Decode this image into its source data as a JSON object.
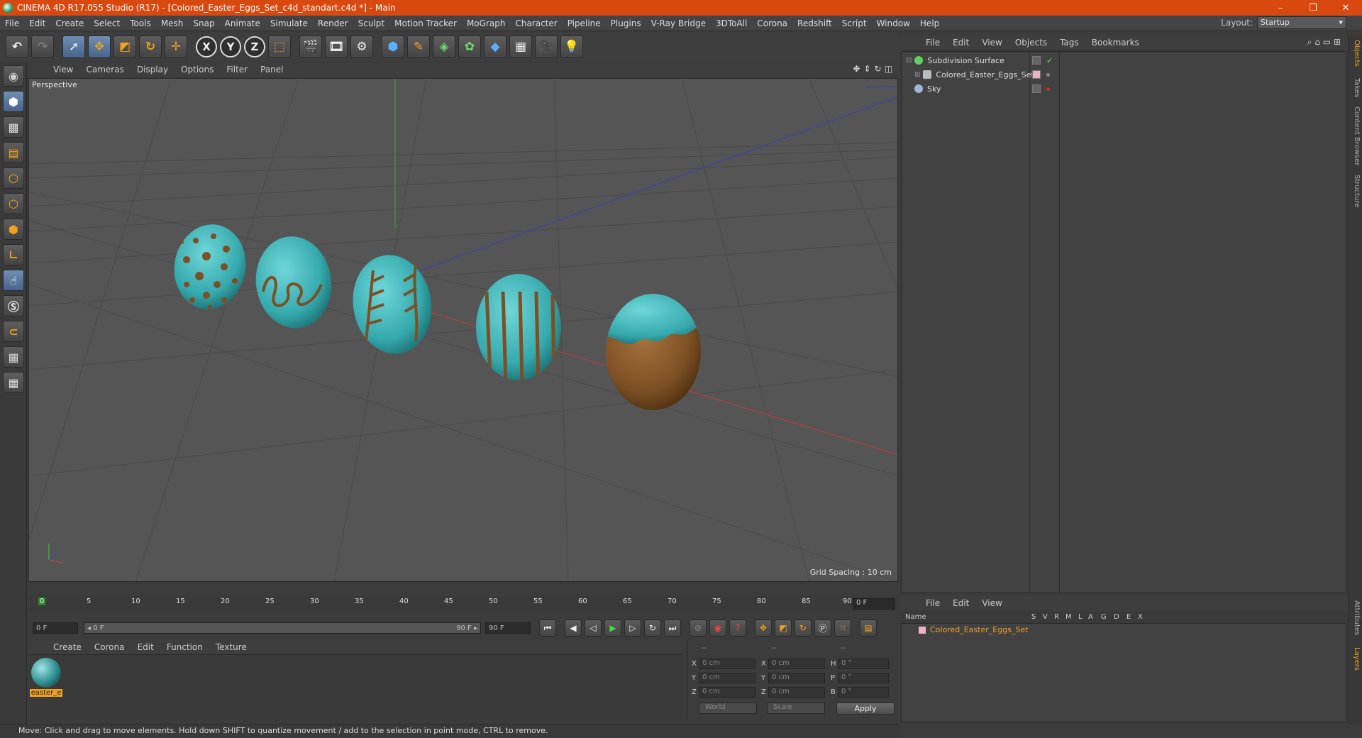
{
  "window": {
    "title": "CINEMA 4D R17.055 Studio (R17) - [Colored_Easter_Eggs_Set_c4d_standart.c4d *] - Main",
    "controls": [
      "–",
      "❐",
      "✕"
    ]
  },
  "menubar": {
    "items": [
      "File",
      "Edit",
      "Create",
      "Select",
      "Tools",
      "Mesh",
      "Snap",
      "Animate",
      "Simulate",
      "Render",
      "Sculpt",
      "Motion Tracker",
      "MoGraph",
      "Character",
      "Pipeline",
      "Plugins",
      "V-Ray Bridge",
      "3DToAll",
      "Corona",
      "Redshift",
      "Script",
      "Window",
      "Help"
    ],
    "layout_label": "Layout:",
    "layout_value": "Startup"
  },
  "viewport": {
    "menu": [
      "View",
      "Cameras",
      "Display",
      "Options",
      "Filter",
      "Panel"
    ],
    "label": "Perspective",
    "grid_spacing": "Grid Spacing : 10 cm"
  },
  "timeline": {
    "ticks": [
      "0",
      "5",
      "10",
      "15",
      "20",
      "25",
      "30",
      "35",
      "40",
      "45",
      "50",
      "55",
      "60",
      "65",
      "70",
      "75",
      "80",
      "85",
      "90"
    ],
    "current_frame": "0 F",
    "start_field": "0 F",
    "slider_start": "◂ 0 F",
    "slider_end": "90 F ▸",
    "end_field": "90 F"
  },
  "material_manager": {
    "menu": [
      "Create",
      "Corona",
      "Edit",
      "Function",
      "Texture"
    ],
    "material_name": "easter_e"
  },
  "coordinates": {
    "headers": [
      "--",
      "--",
      "--"
    ],
    "rows": [
      [
        {
          "axis": "X",
          "value": "0 cm"
        },
        {
          "axis": "X",
          "value": "0 cm"
        },
        {
          "axis": "H",
          "value": "0 °"
        }
      ],
      [
        {
          "axis": "Y",
          "value": "0 cm"
        },
        {
          "axis": "Y",
          "value": "0 cm"
        },
        {
          "axis": "P",
          "value": "0 °"
        }
      ],
      [
        {
          "axis": "Z",
          "value": "0 cm"
        },
        {
          "axis": "Z",
          "value": "0 cm"
        },
        {
          "axis": "B",
          "value": "0 °"
        }
      ]
    ],
    "space": "World",
    "mode": "Scale",
    "apply": "Apply"
  },
  "status": "Move: Click and drag to move elements. Hold down SHIFT to quantize movement / add to the selection in point mode, CTRL to remove.",
  "objects": {
    "menu": [
      "File",
      "Edit",
      "View",
      "Objects",
      "Tags",
      "Bookmarks"
    ],
    "items": [
      {
        "name": "Subdivision Surface",
        "icon_color": "#5fd05f"
      },
      {
        "name": "Colored_Easter_Eggs_Set",
        "icon_color": "#bbbbbb"
      },
      {
        "name": "Sky",
        "icon_color": "#9fb8d8"
      }
    ]
  },
  "right_tabs": [
    "Objects",
    "Takes",
    "Content Browser",
    "Structure",
    "Attributes",
    "Layers"
  ],
  "layers": {
    "menu": [
      "File",
      "Edit",
      "View"
    ],
    "columns": [
      "Name",
      "S",
      "V",
      "R",
      "M",
      "L",
      "A",
      "G",
      "D",
      "E",
      "X"
    ],
    "row": "Colored_Easter_Eggs_Set"
  },
  "colors": {
    "titlebar": "#d9480f",
    "accent": "#f0a020",
    "egg_cyan": "#3cb4b8",
    "egg_brown": "#8a5a2a"
  }
}
